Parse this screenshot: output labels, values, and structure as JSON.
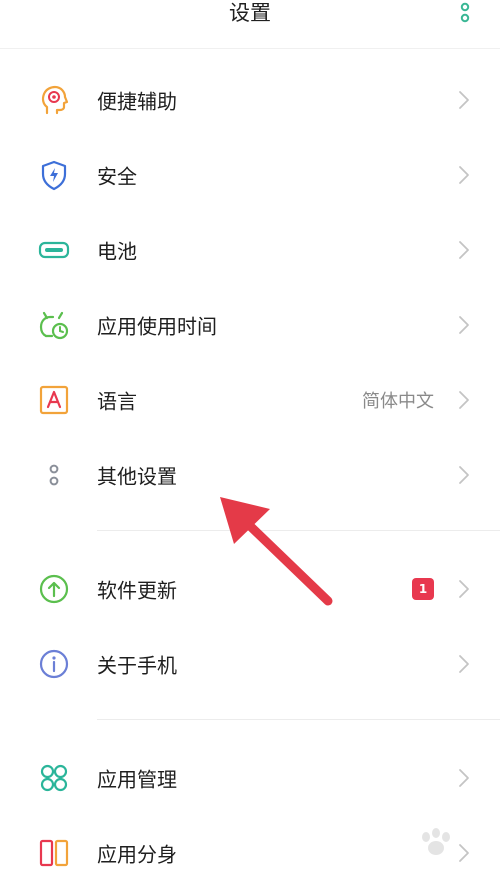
{
  "header": {
    "title": "设置",
    "more_icon": "more-vertical-icon",
    "accent_color": "#3ab795"
  },
  "items": [
    {
      "label": "便捷辅助",
      "icon": "assist-icon",
      "value": "",
      "badge": ""
    },
    {
      "label": "安全",
      "icon": "shield-icon",
      "value": "",
      "badge": ""
    },
    {
      "label": "电池",
      "icon": "battery-icon",
      "value": "",
      "badge": ""
    },
    {
      "label": "应用使用时间",
      "icon": "usage-time-icon",
      "value": "",
      "badge": ""
    },
    {
      "label": "语言",
      "icon": "language-icon",
      "value": "简体中文",
      "badge": ""
    },
    {
      "label": "其他设置",
      "icon": "other-settings-icon",
      "value": "",
      "badge": ""
    },
    {
      "label": "软件更新",
      "icon": "update-icon",
      "value": "",
      "badge": "1"
    },
    {
      "label": "关于手机",
      "icon": "info-icon",
      "value": "",
      "badge": ""
    },
    {
      "label": "应用管理",
      "icon": "app-manage-icon",
      "value": "",
      "badge": ""
    },
    {
      "label": "应用分身",
      "icon": "app-clone-icon",
      "value": "",
      "badge": ""
    }
  ],
  "annotation": {
    "arrow_icon": "red-arrow-annotation",
    "arrow_color": "#e43a48"
  }
}
